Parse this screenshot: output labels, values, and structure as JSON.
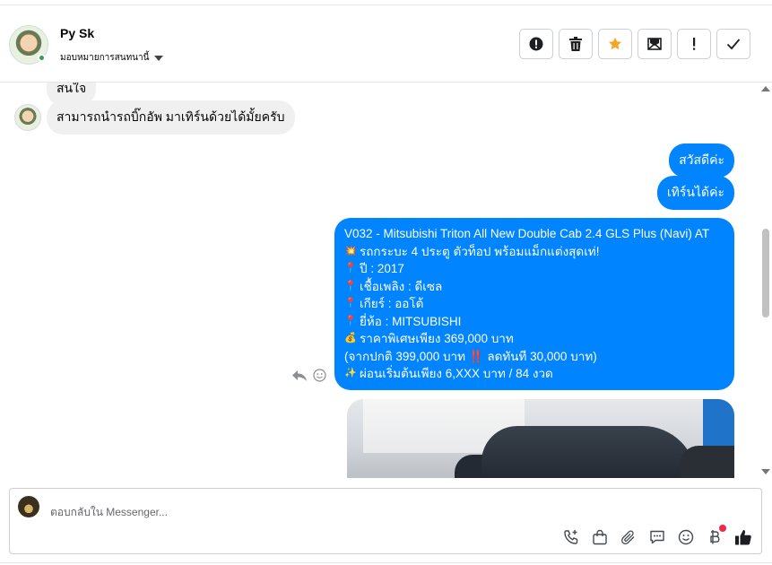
{
  "header": {
    "name": "Py Sk",
    "assign_label": "มอบหมายการสนทนานี้",
    "actions": [
      {
        "name": "mark-spam",
        "icon": "exclamation-circle-icon"
      },
      {
        "name": "delete",
        "icon": "trash-icon"
      },
      {
        "name": "star",
        "icon": "star-icon",
        "color": "#f5a623"
      },
      {
        "name": "mark-unread",
        "icon": "envelope-icon"
      },
      {
        "name": "follow-up",
        "icon": "exclamation-icon"
      },
      {
        "name": "done",
        "icon": "check-icon"
      }
    ]
  },
  "messages": {
    "partial_in": "สนใจ",
    "in_1": "สามารถนำรถบิ๊กอัพ มาเทิร์นด้วยได้มั้ยครับ",
    "out_1": "สวัสดีค่ะ",
    "out_2": "เทิร์นได้ค่ะ",
    "card": {
      "title": "V032 - Mitsubishi Triton All New Double Cab 2.4 GLS Plus (Navi) AT",
      "lines": [
        {
          "emoji": "💥",
          "text": "รถกระบะ 4 ประตู ตัวท็อป พร้อมแม็กแต่งสุดเท่!"
        },
        {
          "emoji": "📍",
          "text": "ปี : 2017"
        },
        {
          "emoji": "📍",
          "text": "เชื้อเพลิง : ดีเซล"
        },
        {
          "emoji": "📍",
          "text": "เกียร์ : ออโต้"
        },
        {
          "emoji": "📍",
          "text": "ยี่ห้อ : MITSUBISHI"
        },
        {
          "emoji": "💰",
          "text": "ราคาพิเศษเพียง 369,000 บาท"
        },
        {
          "emoji": "",
          "text": "(จากปกติ 399,000 บาท ‼️ ลดทันที 30,000 บาท)"
        },
        {
          "emoji": "✨",
          "text": "ผ่อนเริ่มต้นเพียง 6,XXX บาท / 84 งวด"
        }
      ]
    }
  },
  "composer": {
    "placeholder": "ตอบกลับใน Messenger...",
    "tools": [
      "phone-plus-icon",
      "shopping-bag-icon",
      "paperclip-icon",
      "chat-bubble-icon",
      "emoji-icon",
      "baht-icon",
      "thumbs-up-icon"
    ]
  },
  "colors": {
    "accent": "#0084ff",
    "star": "#f5a623",
    "notification": "#f02849"
  }
}
